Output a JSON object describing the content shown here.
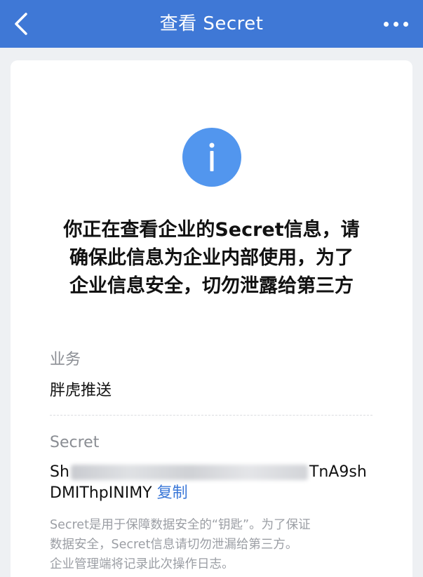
{
  "navbar": {
    "title": "查看 Secret",
    "back_icon": "chevron-left-icon",
    "more_icon": "more-dots-icon"
  },
  "alert": {
    "icon": "info-icon",
    "icon_color": "#5296ee",
    "headline_lines": [
      "你正在查看企业的Secret信息，请",
      "确保此信息为企业内部使用，为了",
      "企业信息安全，切勿泄露给第三方"
    ]
  },
  "business": {
    "label": "业务",
    "value": "胖虎推送"
  },
  "secret": {
    "label": "Secret",
    "value_prefix": "Sh",
    "value_suffix_line1": "TnA9sh",
    "value_line2": "DMIThpINIMY",
    "copy_label": "复制",
    "note_lines": [
      "Secret是用于保障数据安全的“钥匙”。为了保证",
      "数据安全，Secret信息请切勿泄漏给第三方。",
      "企业管理端将记录此次操作日志。"
    ]
  },
  "colors": {
    "navbar": "#3f78d6",
    "link": "#3b78d8",
    "background": "#eef0f3"
  }
}
